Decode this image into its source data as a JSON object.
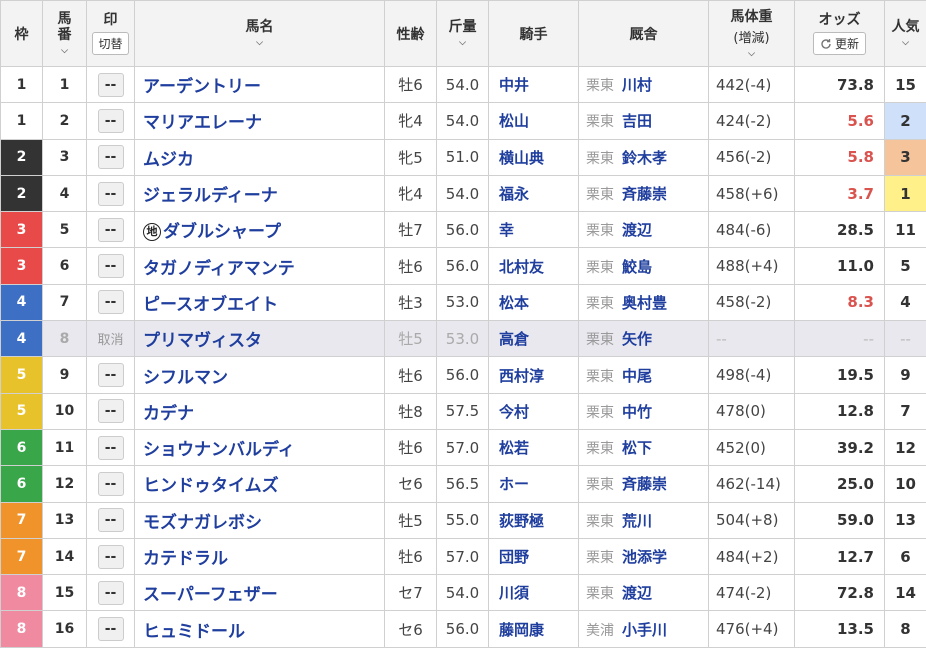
{
  "header": {
    "waku": "枠",
    "umaban_top": "馬",
    "umaban_bottom": "番",
    "mark": "印",
    "switch": "切替",
    "horse": "馬名",
    "sexage": "性齢",
    "weight": "斤量",
    "jockey": "騎手",
    "stable": "厩舎",
    "bodyweight": "馬体重",
    "bodyweight_sub": "(増減)",
    "odds": "オッズ",
    "refresh": "更新",
    "pop": "人気"
  },
  "colors": {
    "frame_1": "#ffffff",
    "frame_2": "#333333",
    "frame_3": "#e84a4a",
    "frame_4": "#3d6fc4",
    "frame_5": "#e8c22a",
    "frame_6": "#3aa64a",
    "frame_7": "#f0932b",
    "frame_8": "#f08aa0",
    "pop_1": "#fff08a",
    "pop_2": "#cfe0fb",
    "pop_3": "#f5c49b",
    "link": "#1f3e9e",
    "hot_odds": "#d9534f"
  },
  "rows": [
    {
      "waku": "1",
      "num": "1",
      "mark": "--",
      "horse": "アーデントリー",
      "chi": "",
      "sexage": "牡6",
      "weight": "54.0",
      "jockey": "中井",
      "area": "栗東",
      "trainer": "川村",
      "bw": "442(-4)",
      "odds": "73.8",
      "pop": "15",
      "hot": false
    },
    {
      "waku": "1",
      "num": "2",
      "mark": "--",
      "horse": "マリアエレーナ",
      "chi": "",
      "sexage": "牝4",
      "weight": "54.0",
      "jockey": "松山",
      "area": "栗東",
      "trainer": "吉田",
      "bw": "424(-2)",
      "odds": "5.6",
      "pop": "2",
      "hot": true
    },
    {
      "waku": "2",
      "num": "3",
      "mark": "--",
      "horse": "ムジカ",
      "chi": "",
      "sexage": "牝5",
      "weight": "51.0",
      "jockey": "横山典",
      "area": "栗東",
      "trainer": "鈴木孝",
      "bw": "456(-2)",
      "odds": "5.8",
      "pop": "3",
      "hot": true
    },
    {
      "waku": "2",
      "num": "4",
      "mark": "--",
      "horse": "ジェラルディーナ",
      "chi": "",
      "sexage": "牝4",
      "weight": "54.0",
      "jockey": "福永",
      "area": "栗東",
      "trainer": "斉藤崇",
      "bw": "458(+6)",
      "odds": "3.7",
      "pop": "1",
      "hot": true
    },
    {
      "waku": "3",
      "num": "5",
      "mark": "--",
      "horse": "ダブルシャープ",
      "chi": "地",
      "sexage": "牡7",
      "weight": "56.0",
      "jockey": "幸",
      "area": "栗東",
      "trainer": "渡辺",
      "bw": "484(-6)",
      "odds": "28.5",
      "pop": "11",
      "hot": false
    },
    {
      "waku": "3",
      "num": "6",
      "mark": "--",
      "horse": "タガノディアマンテ",
      "chi": "",
      "sexage": "牡6",
      "weight": "56.0",
      "jockey": "北村友",
      "area": "栗東",
      "trainer": "鮫島",
      "bw": "488(+4)",
      "odds": "11.0",
      "pop": "5",
      "hot": false
    },
    {
      "waku": "4",
      "num": "7",
      "mark": "--",
      "horse": "ピースオブエイト",
      "chi": "",
      "sexage": "牡3",
      "weight": "53.0",
      "jockey": "松本",
      "area": "栗東",
      "trainer": "奥村豊",
      "bw": "458(-2)",
      "odds": "8.3",
      "pop": "4",
      "hot": true
    },
    {
      "waku": "4",
      "num": "8",
      "mark": "取消",
      "horse": "プリマヴィスタ",
      "chi": "",
      "sexage": "牡5",
      "weight": "53.0",
      "jockey": "高倉",
      "area": "栗東",
      "trainer": "矢作",
      "bw": "--",
      "odds": "--",
      "pop": "--",
      "hot": false,
      "scratched": true
    },
    {
      "waku": "5",
      "num": "9",
      "mark": "--",
      "horse": "シフルマン",
      "chi": "",
      "sexage": "牡6",
      "weight": "56.0",
      "jockey": "西村淳",
      "area": "栗東",
      "trainer": "中尾",
      "bw": "498(-4)",
      "odds": "19.5",
      "pop": "9",
      "hot": false
    },
    {
      "waku": "5",
      "num": "10",
      "mark": "--",
      "horse": "カデナ",
      "chi": "",
      "sexage": "牡8",
      "weight": "57.5",
      "jockey": "今村",
      "area": "栗東",
      "trainer": "中竹",
      "bw": "478(0)",
      "odds": "12.8",
      "pop": "7",
      "hot": false
    },
    {
      "waku": "6",
      "num": "11",
      "mark": "--",
      "horse": "ショウナンバルディ",
      "chi": "",
      "sexage": "牡6",
      "weight": "57.0",
      "jockey": "松若",
      "area": "栗東",
      "trainer": "松下",
      "bw": "452(0)",
      "odds": "39.2",
      "pop": "12",
      "hot": false
    },
    {
      "waku": "6",
      "num": "12",
      "mark": "--",
      "horse": "ヒンドゥタイムズ",
      "chi": "",
      "sexage": "セ6",
      "weight": "56.5",
      "jockey": "ホー",
      "area": "栗東",
      "trainer": "斉藤崇",
      "bw": "462(-14)",
      "odds": "25.0",
      "pop": "10",
      "hot": false
    },
    {
      "waku": "7",
      "num": "13",
      "mark": "--",
      "horse": "モズナガレボシ",
      "chi": "",
      "sexage": "牡5",
      "weight": "55.0",
      "jockey": "荻野極",
      "area": "栗東",
      "trainer": "荒川",
      "bw": "504(+8)",
      "odds": "59.0",
      "pop": "13",
      "hot": false
    },
    {
      "waku": "7",
      "num": "14",
      "mark": "--",
      "horse": "カテドラル",
      "chi": "",
      "sexage": "牡6",
      "weight": "57.0",
      "jockey": "団野",
      "area": "栗東",
      "trainer": "池添学",
      "bw": "484(+2)",
      "odds": "12.7",
      "pop": "6",
      "hot": false
    },
    {
      "waku": "8",
      "num": "15",
      "mark": "--",
      "horse": "スーパーフェザー",
      "chi": "",
      "sexage": "セ7",
      "weight": "54.0",
      "jockey": "川須",
      "area": "栗東",
      "trainer": "渡辺",
      "bw": "474(-2)",
      "odds": "72.8",
      "pop": "14",
      "hot": false
    },
    {
      "waku": "8",
      "num": "16",
      "mark": "--",
      "horse": "ヒュミドール",
      "chi": "",
      "sexage": "セ6",
      "weight": "56.0",
      "jockey": "藤岡康",
      "area": "美浦",
      "trainer": "小手川",
      "bw": "476(+4)",
      "odds": "13.5",
      "pop": "8",
      "hot": false
    }
  ]
}
